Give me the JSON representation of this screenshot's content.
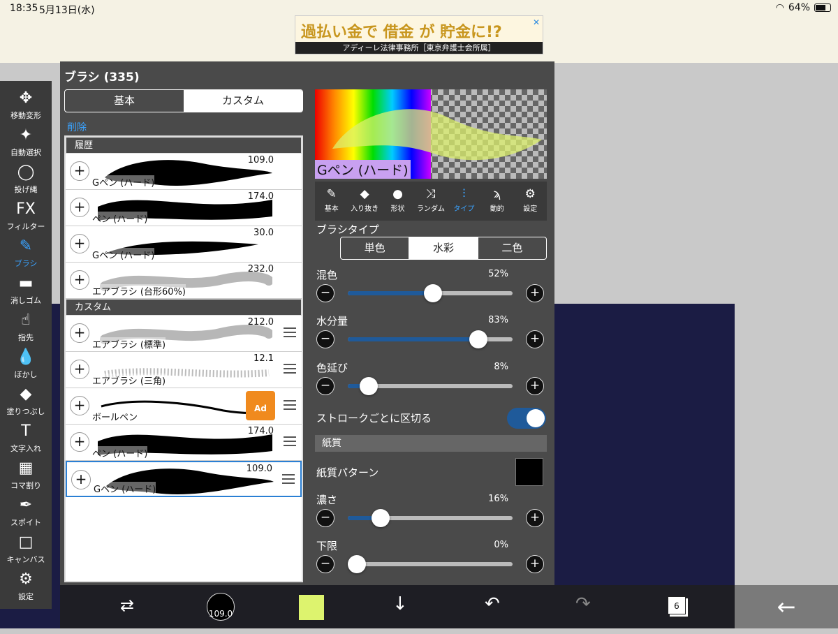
{
  "status": {
    "time": "18:35",
    "date": "5月13日(水)",
    "battery": "64%"
  },
  "ad": {
    "headline": "過払い金で 借金 が 貯金に!?",
    "sub": "アディーレ法律事務所［東京弁護士会所属］",
    "close": "✕"
  },
  "toolbar": [
    {
      "label": "移動変形",
      "icon": "move-icon"
    },
    {
      "label": "自動選択",
      "icon": "magic-wand-icon"
    },
    {
      "label": "投げ縄",
      "icon": "lasso-icon"
    },
    {
      "label": "フィルター",
      "icon": "fx-icon"
    },
    {
      "label": "ブラシ",
      "icon": "brush-icon",
      "active": true
    },
    {
      "label": "消しゴム",
      "icon": "eraser-icon"
    },
    {
      "label": "指先",
      "icon": "finger-icon"
    },
    {
      "label": "ぼかし",
      "icon": "blur-drop-icon"
    },
    {
      "label": "塗りつぶし",
      "icon": "bucket-icon"
    },
    {
      "label": "文字入れ",
      "icon": "text-icon"
    },
    {
      "label": "コマ割り",
      "icon": "frame-icon"
    },
    {
      "label": "スポイト",
      "icon": "eyedropper-icon"
    },
    {
      "label": "キャンバス",
      "icon": "canvas-icon"
    },
    {
      "label": "設定",
      "icon": "gear-icon"
    }
  ],
  "panel": {
    "title": "ブラシ (335)",
    "tabs": [
      "基本",
      "カスタム"
    ],
    "selected_tab": 1,
    "delete": "削除",
    "section_history": "履歴",
    "section_custom": "カスタム",
    "history": [
      {
        "name": "Gペン (ハード)",
        "size": "109.0"
      },
      {
        "name": "ペン (ハード)",
        "size": "174.0"
      },
      {
        "name": "Gペン (ハード)",
        "size": "30.0"
      },
      {
        "name": "エアブラシ (台形60%)",
        "size": "232.0"
      }
    ],
    "custom": [
      {
        "name": "エアブラシ (標準)",
        "size": "212.0"
      },
      {
        "name": "エアブラシ (三角)",
        "size": "12.1"
      },
      {
        "name": "ボールペン",
        "size": "",
        "locked": "Ad"
      },
      {
        "name": "ペン (ハード)",
        "size": "174.0"
      },
      {
        "name": "Gペン (ハード)",
        "size": "109.0",
        "selected": true
      }
    ],
    "preview_name": "Gペン (ハード)",
    "prop_tabs": [
      {
        "label": "基本",
        "icon": "brush-icon"
      },
      {
        "label": "入り抜き",
        "icon": "taper-icon"
      },
      {
        "label": "形状",
        "icon": "shape-icon"
      },
      {
        "label": "ランダム",
        "icon": "shuffle-icon"
      },
      {
        "label": "タイプ",
        "icon": "type-icon",
        "selected": true
      },
      {
        "label": "動的",
        "icon": "dynamic-icon"
      },
      {
        "label": "設定",
        "icon": "gear-icon"
      }
    ],
    "brush_type_label": "ブラシタイプ",
    "brush_types": [
      "単色",
      "水彩",
      "二色"
    ],
    "brush_type_selected": 1,
    "sliders": [
      {
        "label": "混色",
        "value": "52%",
        "fraction": 0.52
      },
      {
        "label": "水分量",
        "value": "83%",
        "fraction": 0.83
      },
      {
        "label": "色延び",
        "value": "8%",
        "fraction": 0.08
      }
    ],
    "stroke_toggle_label": "ストロークごとに区切る",
    "stroke_toggle_on": true,
    "paper_header": "紙質",
    "paper_pattern_label": "紙質パターン",
    "paper_sliders": [
      {
        "label": "濃さ",
        "value": "16%",
        "fraction": 0.16
      },
      {
        "label": "下限",
        "value": "0%",
        "fraction": 0.0
      }
    ]
  },
  "bottom": {
    "brush_size": "109.0",
    "color": "#ddf36e",
    "layers": "6"
  },
  "colors": {
    "accent": "#3aa3ff",
    "slider_fill": "#1f5a9a",
    "panel": "#4a4a4a",
    "canvas": "#1b1c44"
  }
}
